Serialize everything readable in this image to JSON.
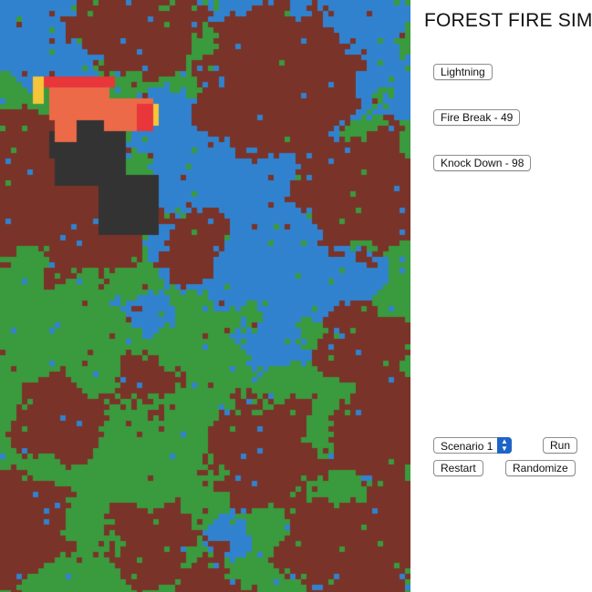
{
  "title": "FOREST FIRE SIM",
  "buttons": {
    "lightning": "Lightning",
    "fire_break": "Fire Break - 49",
    "knock_down": "Knock Down - 98",
    "run": "Run",
    "restart": "Restart",
    "randomize": "Randomize"
  },
  "scenario": {
    "selected": "Scenario 1"
  },
  "colors": {
    "forest": "#3a9a3e",
    "dry_land": "#7a3328",
    "water": "#3182ce",
    "burned": "#333333",
    "burning": "#ec6a48",
    "fire_edge_red": "#e8363a",
    "fire_edge_yellow": "#f5c53a",
    "scenario_arrows": "#1e64c8"
  },
  "icons": {
    "scenario_stepper": "up-down-chevron-icon"
  }
}
